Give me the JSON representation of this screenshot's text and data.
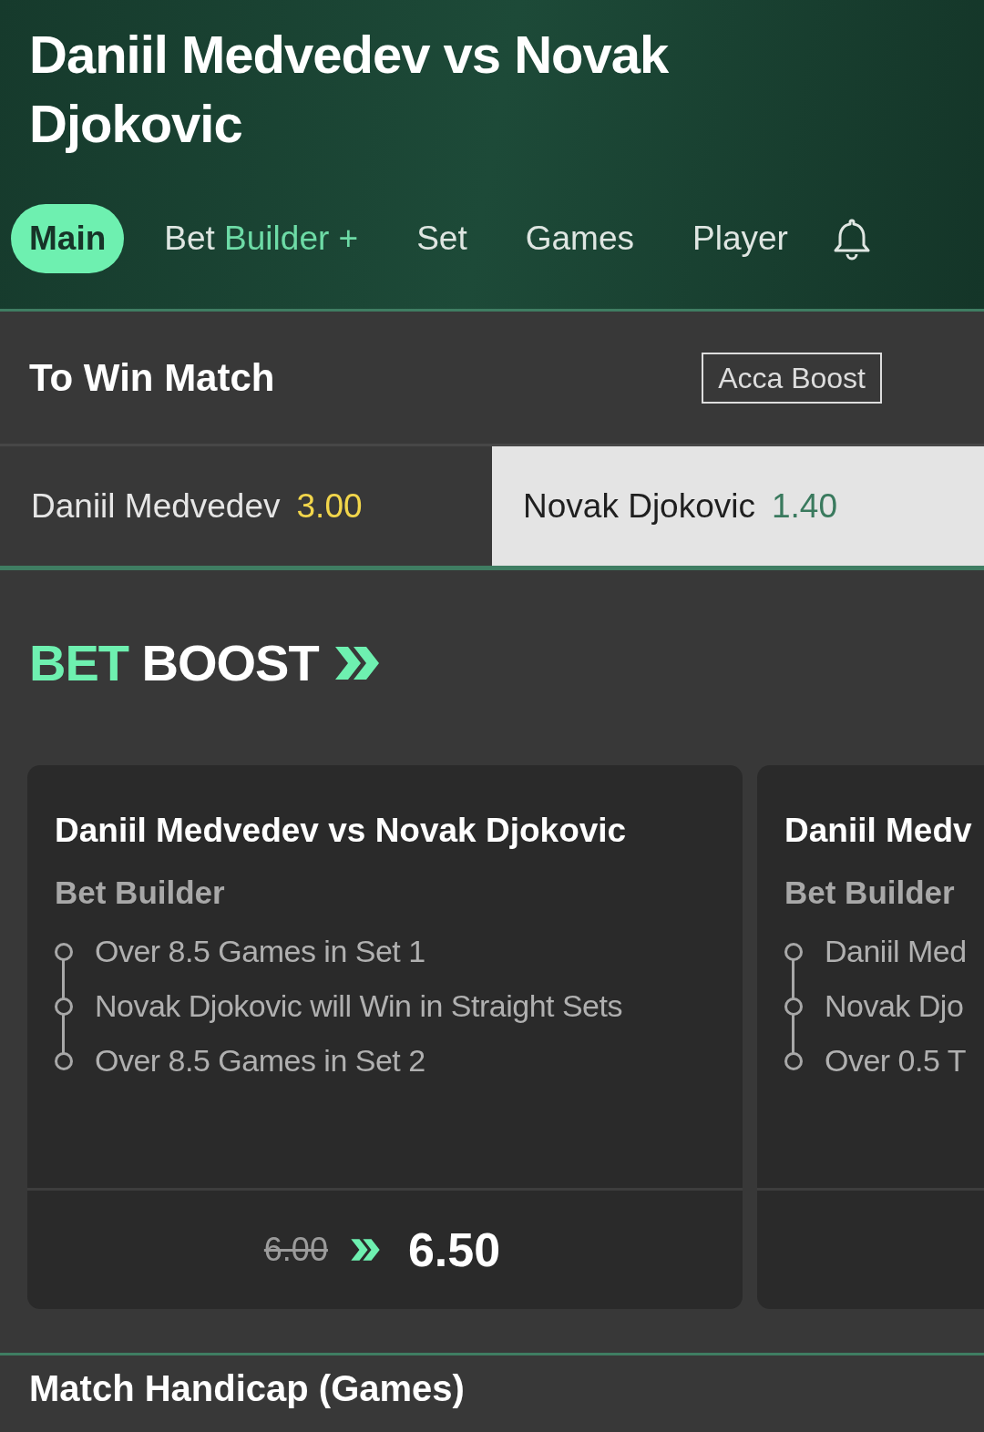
{
  "header": {
    "title": "Daniil Medvedev vs Novak Djokovic"
  },
  "tabs": [
    {
      "label": "Main",
      "selected": true
    },
    {
      "label": "Bet ",
      "accent": "Builder +",
      "selected": false
    },
    {
      "label": "Set",
      "selected": false
    },
    {
      "label": "Games",
      "selected": false
    },
    {
      "label": "Player",
      "selected": false
    }
  ],
  "market": {
    "title": "To Win Match",
    "badge": "Acca Boost",
    "selections": [
      {
        "name": "Daniil Medvedev",
        "odds": "3.00",
        "selected": false
      },
      {
        "name": "Novak Djokovic",
        "odds": "1.40",
        "selected": true
      }
    ]
  },
  "bet_boost": {
    "title_accent": "BET",
    "title": "BOOST",
    "cards": [
      {
        "title": "Daniil Medvedev vs Novak Djokovic",
        "subtitle": "Bet Builder",
        "legs": [
          "Over 8.5 Games in Set 1",
          "Novak Djokovic will Win in Straight Sets",
          "Over 8.5 Games in Set 2"
        ],
        "old_odds": "6.00",
        "new_odds": "6.50"
      },
      {
        "title": "Daniil Medv",
        "subtitle": "Bet Builder",
        "legs": [
          "Daniil Med",
          "Novak Djo",
          "Over 0.5 T"
        ]
      }
    ]
  },
  "next_section": {
    "title": "Match Handicap (Games)"
  }
}
